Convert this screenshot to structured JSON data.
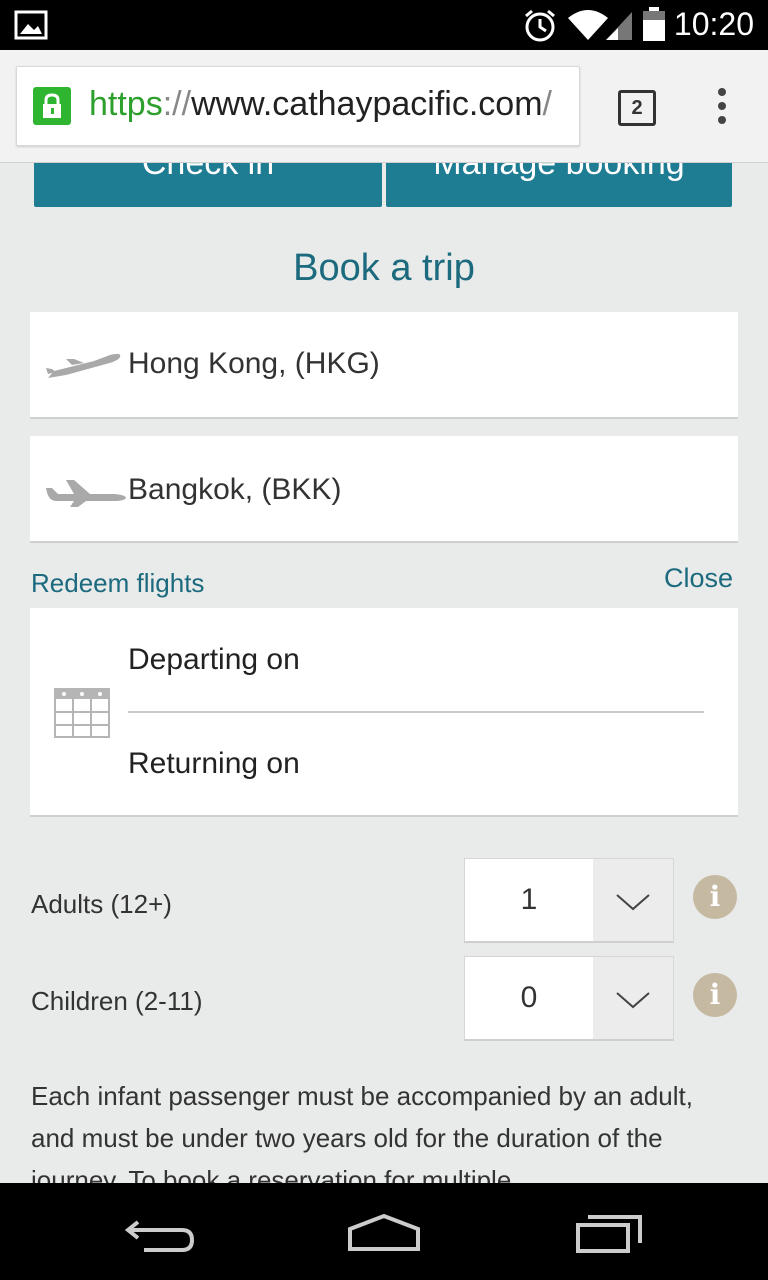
{
  "status_bar": {
    "time": "10:20"
  },
  "browser": {
    "url_scheme": "https",
    "url_sep": "://",
    "url_host": "www.cathaypacific.com",
    "url_trail": "/",
    "tab_count": "2"
  },
  "page": {
    "checkin_label": "Check in",
    "manage_label": "Manage booking",
    "title": "Book a trip",
    "from_value": "Hong Kong, (HKG)",
    "to_value": "Bangkok, (BKK)",
    "redeem_link": "Redeem flights",
    "close_link": "Close",
    "departing_label": "Departing on",
    "returning_label": "Returning on",
    "adults_label": "Adults (12+)",
    "adults_value": "1",
    "children_label": "Children (2-11)",
    "children_value": "0",
    "info_glyph": "i",
    "infant_note": "Each infant passenger must be accompanied by an adult, and must be under two years old for the duration of the journey. To book a reservation for multiple"
  },
  "icons": [
    "image-icon",
    "alarm-icon",
    "wifi-icon",
    "signal-icon",
    "battery-icon",
    "lock-icon",
    "tabs-icon",
    "overflow-menu-icon",
    "departure-plane-icon",
    "arrival-plane-icon",
    "calendar-icon",
    "chevron-down-icon",
    "info-icon",
    "back-icon",
    "home-icon",
    "recents-icon"
  ]
}
